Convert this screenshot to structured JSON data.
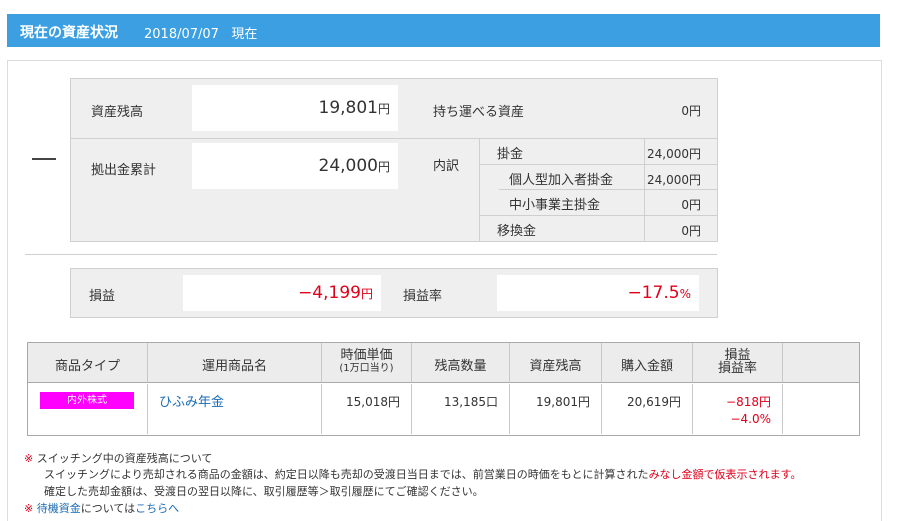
{
  "header": {
    "title": "現在の資産状況",
    "date": "2018/07/07",
    "suffix": "現在"
  },
  "summary": {
    "asset_balance_label": "資産残高",
    "asset_balance_value": "19,801",
    "contribution_label": "拠出金累計",
    "contribution_value": "24,000",
    "yen": "円",
    "portable_label": "持ち運べる資産",
    "portable_value": "0円",
    "breakdown_label": "内訳",
    "breakdown": [
      {
        "label": "掛金",
        "value": "24,000円"
      },
      {
        "label": "個人型加入者掛金",
        "value": "24,000円"
      },
      {
        "label": "中小事業主掛金",
        "value": "0円"
      },
      {
        "label": "移換金",
        "value": "0円"
      }
    ]
  },
  "profit": {
    "label": "損益",
    "value": "−4,199",
    "unit": "円",
    "rate_label": "損益率",
    "rate_value": "−17.5",
    "rate_unit": "%"
  },
  "table": {
    "headers": {
      "type": "商品タイプ",
      "name": "運用商品名",
      "price": "時価単価",
      "price_sub": "(1万口当り)",
      "qty": "残高数量",
      "balance": "資産残高",
      "purchase": "購入金額",
      "pl": "損益",
      "pl_rate": "損益率"
    },
    "row": {
      "type": "内外株式",
      "name": "ひふみ年金",
      "price": "15,018円",
      "qty": "13,185口",
      "balance": "19,801円",
      "purchase": "20,619円",
      "pl": "−818円",
      "pl_rate": "−4.0%"
    }
  },
  "notes": {
    "mark": "※",
    "line1": "スイッチング中の資産残高について",
    "line2a": "スイッチングにより売却される商品の金額は、約定日以降も売却の受渡日当日までは、前営業日の時価をもとに計算された",
    "line2b": "みなし金額で仮表示されます。",
    "line3": "確定した売却金額は、受渡日の翌日以降に、取引履歴等＞取引履歴にてご確認ください。",
    "line4a": "待機資金",
    "line4b": "については",
    "line4c": "こちらへ"
  }
}
